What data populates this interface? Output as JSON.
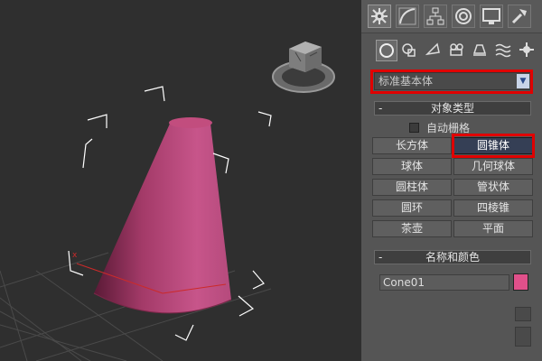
{
  "dropdown": {
    "selected": "标准基本体"
  },
  "object_type": {
    "header": "对象类型",
    "autogrid_label": "自动栅格",
    "buttons": [
      {
        "label": "长方体",
        "active": false
      },
      {
        "label": "圆锥体",
        "active": true
      },
      {
        "label": "球体",
        "active": false
      },
      {
        "label": "几何球体",
        "active": false
      },
      {
        "label": "圆柱体",
        "active": false
      },
      {
        "label": "管状体",
        "active": false
      },
      {
        "label": "圆环",
        "active": false
      },
      {
        "label": "四棱锥",
        "active": false
      },
      {
        "label": "茶壶",
        "active": false
      },
      {
        "label": "平面",
        "active": false
      }
    ]
  },
  "name_color": {
    "header": "名称和颜色",
    "name_value": "Cone01",
    "color": "#e0508a"
  },
  "colors": {
    "cone": "#c0507a",
    "highlight": "#e00000"
  }
}
